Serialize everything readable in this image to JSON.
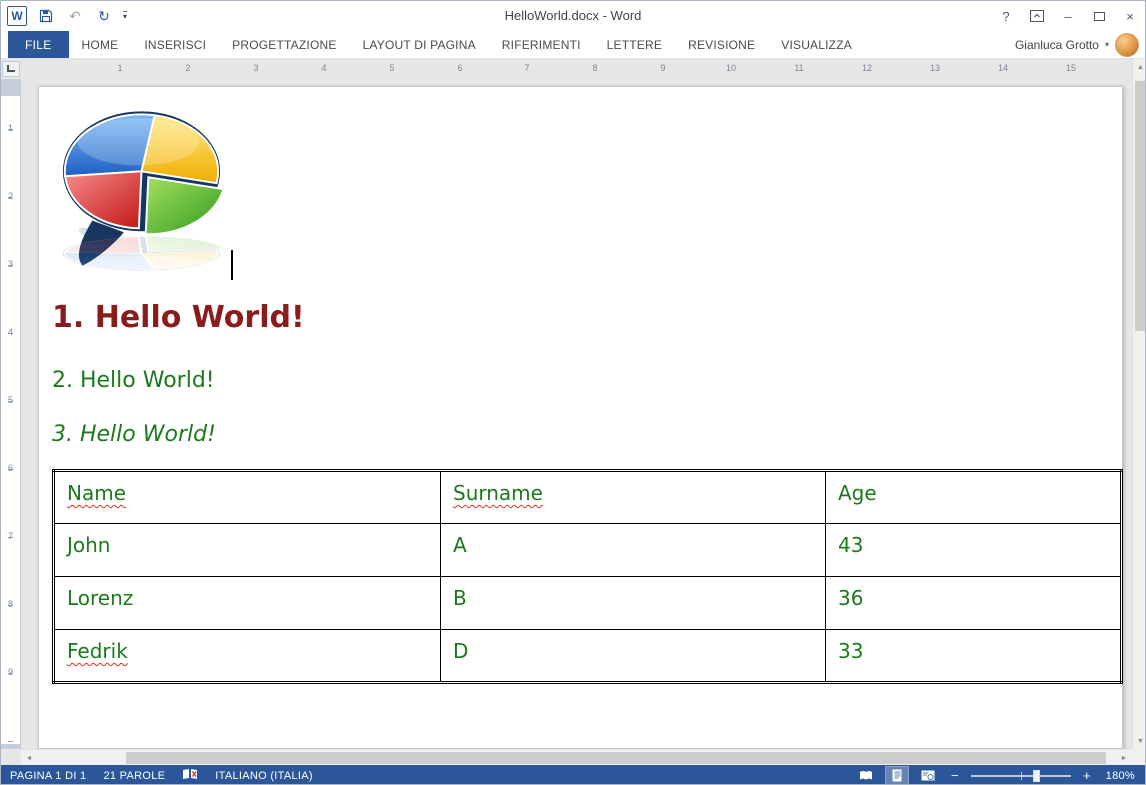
{
  "window": {
    "title": "HelloWorld.docx - Word"
  },
  "icons": {
    "word_logo": "W",
    "help": "?",
    "minimize": "–",
    "close": "×",
    "undo": "↶",
    "redo": "↻",
    "dropdown": "▾",
    "scroll_up": "▲",
    "scroll_down": "▼",
    "scroll_left": "◄",
    "scroll_right": "►",
    "zoom_out": "−",
    "zoom_in": "+"
  },
  "ribbon": {
    "file_tab": "FILE",
    "tabs": [
      "HOME",
      "INSERISCI",
      "PROGETTAZIONE",
      "LAYOUT DI PAGINA",
      "RIFERIMENTI",
      "LETTERE",
      "REVISIONE",
      "VISUALIZZA"
    ],
    "user": "Gianluca Grotto"
  },
  "ruler": {
    "horizontal": [
      "1",
      "2",
      "3",
      "4",
      "5",
      "6",
      "7",
      "8",
      "9",
      "10",
      "11",
      "12",
      "13",
      "14",
      "15"
    ],
    "vertical": [
      "1",
      "2",
      "3",
      "4",
      "5",
      "6",
      "7",
      "8",
      "9"
    ]
  },
  "document": {
    "headings": [
      "1. Hello World!",
      "2. Hello World!",
      "3. Hello World!"
    ],
    "table": {
      "headers": [
        "Name",
        "Surname",
        "Age"
      ],
      "rows": [
        [
          "John",
          "A",
          "43"
        ],
        [
          "Lorenz",
          "B",
          "36"
        ],
        [
          "Fedrik",
          "D",
          "33"
        ]
      ]
    }
  },
  "status": {
    "page": "PAGINA 1 DI 1",
    "words": "21 PAROLE",
    "language": "ITALIANO (ITALIA)",
    "zoom": "180%"
  },
  "colors": {
    "accent": "#2b579a",
    "heading1_red": "#8b1c1c",
    "document_green": "#1b7a1b",
    "spellcheck_squiggle": "#e03022"
  }
}
